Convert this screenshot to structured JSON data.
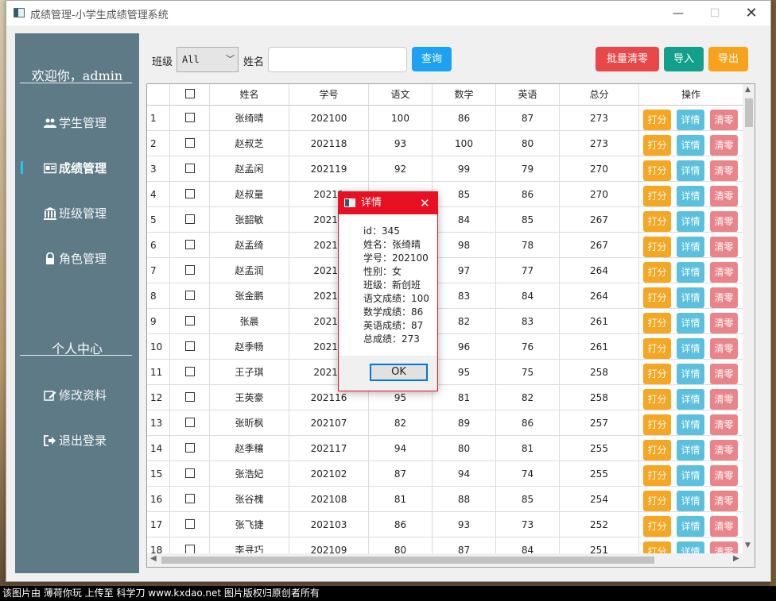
{
  "window": {
    "title": "成绩管理-小学生成绩管理系统",
    "min_icon": "—",
    "max_icon": "☐",
    "close_icon": "✕"
  },
  "sidebar": {
    "welcome": "欢迎你，admin",
    "items": [
      {
        "label": "学生管理",
        "icon": "users-icon"
      },
      {
        "label": "成绩管理",
        "icon": "id-card-icon",
        "active": true
      },
      {
        "label": "班级管理",
        "icon": "institution-icon"
      },
      {
        "label": "角色管理",
        "icon": "lock-icon"
      }
    ],
    "center_title": "个人中心",
    "center_items": [
      {
        "label": "修改资料",
        "icon": "edit-icon"
      },
      {
        "label": "退出登录",
        "icon": "sign-out-icon"
      }
    ]
  },
  "search": {
    "class_label": "班级",
    "class_value": "All",
    "name_label": "姓名",
    "name_value": "",
    "query_button": "查询"
  },
  "toolbar": {
    "batch_clear": "批量清零",
    "import": "导入",
    "export": "导出"
  },
  "table": {
    "columns": [
      "",
      "",
      "姓名",
      "学号",
      "语文",
      "数学",
      "英语",
      "总分",
      "操作"
    ],
    "actions": {
      "score": "打分",
      "detail": "详情",
      "clear": "清零"
    },
    "rows": [
      {
        "n": "1",
        "name": "张绮晴",
        "id": "202100",
        "chinese": "100",
        "math": "86",
        "english": "87",
        "total": "273"
      },
      {
        "n": "2",
        "name": "赵叔芝",
        "id": "202118",
        "chinese": "93",
        "math": "100",
        "english": "80",
        "total": "273"
      },
      {
        "n": "3",
        "name": "赵孟闲",
        "id": "202119",
        "chinese": "92",
        "math": "99",
        "english": "79",
        "total": "270"
      },
      {
        "n": "4",
        "name": "赵叔量",
        "id": "20211",
        "chinese": "",
        "math": "85",
        "english": "86",
        "total": "270"
      },
      {
        "n": "5",
        "name": "张韶敏",
        "id": "20211",
        "chinese": "",
        "math": "84",
        "english": "85",
        "total": "267"
      },
      {
        "n": "6",
        "name": "赵孟绮",
        "id": "20212",
        "chinese": "",
        "math": "98",
        "english": "78",
        "total": "267"
      },
      {
        "n": "7",
        "name": "赵孟润",
        "id": "20211",
        "chinese": "",
        "math": "97",
        "english": "77",
        "total": "264"
      },
      {
        "n": "8",
        "name": "张金鹏",
        "id": "20211",
        "chinese": "",
        "math": "83",
        "english": "84",
        "total": "264"
      },
      {
        "n": "9",
        "name": "张晨",
        "id": "20211",
        "chinese": "",
        "math": "82",
        "english": "83",
        "total": "261"
      },
      {
        "n": "10",
        "name": "赵季畅",
        "id": "20211",
        "chinese": "",
        "math": "96",
        "english": "76",
        "total": "261"
      },
      {
        "n": "11",
        "name": "王子琪",
        "id": "20210",
        "chinese": "",
        "math": "95",
        "english": "75",
        "total": "258"
      },
      {
        "n": "12",
        "name": "王英豪",
        "id": "202116",
        "chinese": "95",
        "math": "81",
        "english": "82",
        "total": "258"
      },
      {
        "n": "13",
        "name": "张昕枫",
        "id": "202107",
        "chinese": "82",
        "math": "89",
        "english": "86",
        "total": "257"
      },
      {
        "n": "14",
        "name": "赵季穰",
        "id": "202117",
        "chinese": "94",
        "math": "80",
        "english": "81",
        "total": "255"
      },
      {
        "n": "15",
        "name": "张浩妃",
        "id": "202102",
        "chinese": "87",
        "math": "94",
        "english": "74",
        "total": "255"
      },
      {
        "n": "16",
        "name": "张谷槐",
        "id": "202108",
        "chinese": "81",
        "math": "88",
        "english": "85",
        "total": "254"
      },
      {
        "n": "17",
        "name": "张飞捷",
        "id": "202103",
        "chinese": "86",
        "math": "93",
        "english": "73",
        "total": "252"
      },
      {
        "n": "18",
        "name": "李寻巧",
        "id": "202109",
        "chinese": "80",
        "math": "87",
        "english": "84",
        "total": "251"
      }
    ]
  },
  "dialog": {
    "title": "详情",
    "lines": [
      "id：345",
      "姓名：张绮晴",
      "学号：202100",
      "性别：女",
      "班级：新创班",
      "语文成绩：100",
      "数学成绩：86",
      "英语成绩：87",
      "总成绩：273"
    ],
    "ok": "OK",
    "close_icon": "✕"
  },
  "caption": "该图片由 薄荷你玩 上传至 科学刀 www.kxdao.net 图片版权归原创者所有",
  "colors": {
    "sidebar_bg": "#5f7a87",
    "query": "#1da1f2",
    "batch_clear": "#e8484a",
    "import": "#12a08c",
    "export": "#f7a21b",
    "score": "#f5a623",
    "detail": "#5bc0de",
    "clear": "#e9858a",
    "dialog_accent": "#e81123"
  }
}
